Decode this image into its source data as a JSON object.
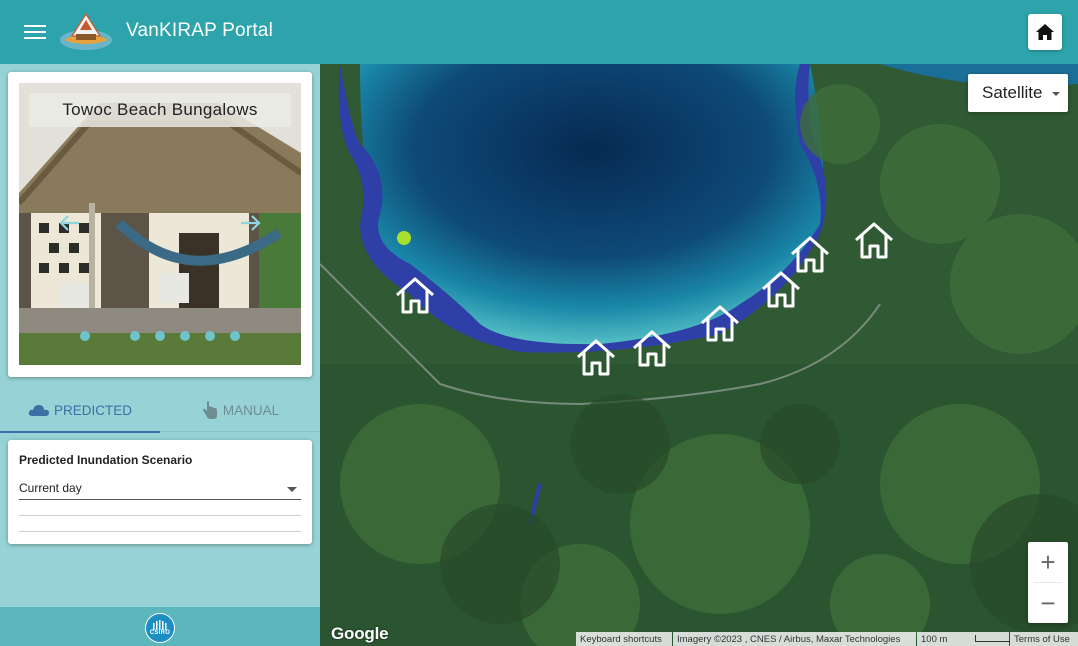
{
  "header": {
    "title": "VanKIRAP Portal"
  },
  "sidebar": {
    "location_card": {
      "title": "Towoc Beach Bungalows",
      "carousel_index": 1,
      "carousel_count": 7
    },
    "tabs": [
      {
        "label": "PREDICTED",
        "icon": "cloud-icon",
        "active": true
      },
      {
        "label": "MANUAL",
        "icon": "hand-pointer-icon",
        "active": false
      }
    ],
    "scenario": {
      "label": "Predicted Inundation Scenario",
      "value": "Current day"
    },
    "footer": {
      "logo_text": "CSIRO"
    }
  },
  "map": {
    "map_type": "Satellite",
    "zoom_in_label": "+",
    "zoom_out_label": "−",
    "google_logo": "Google",
    "attribution": {
      "keyboard": "Keyboard shortcuts",
      "imagery": "Imagery ©2023 , CNES / Airbus, Maxar Technologies",
      "scale": "100 m",
      "terms": "Terms of Use"
    },
    "markers": [
      {
        "type": "house-icon"
      },
      {
        "type": "house-icon"
      },
      {
        "type": "house-icon"
      },
      {
        "type": "house-icon"
      },
      {
        "type": "house-icon"
      },
      {
        "type": "house-icon"
      },
      {
        "type": "house-icon"
      },
      {
        "type": "house-icon"
      }
    ],
    "colors": {
      "inundation": "#2e3fa8",
      "selected_marker": "#a6e02a"
    }
  },
  "colors": {
    "header": "#2da3ab",
    "sidebar": "#97d3d6",
    "accent": "#3e6fa8"
  }
}
